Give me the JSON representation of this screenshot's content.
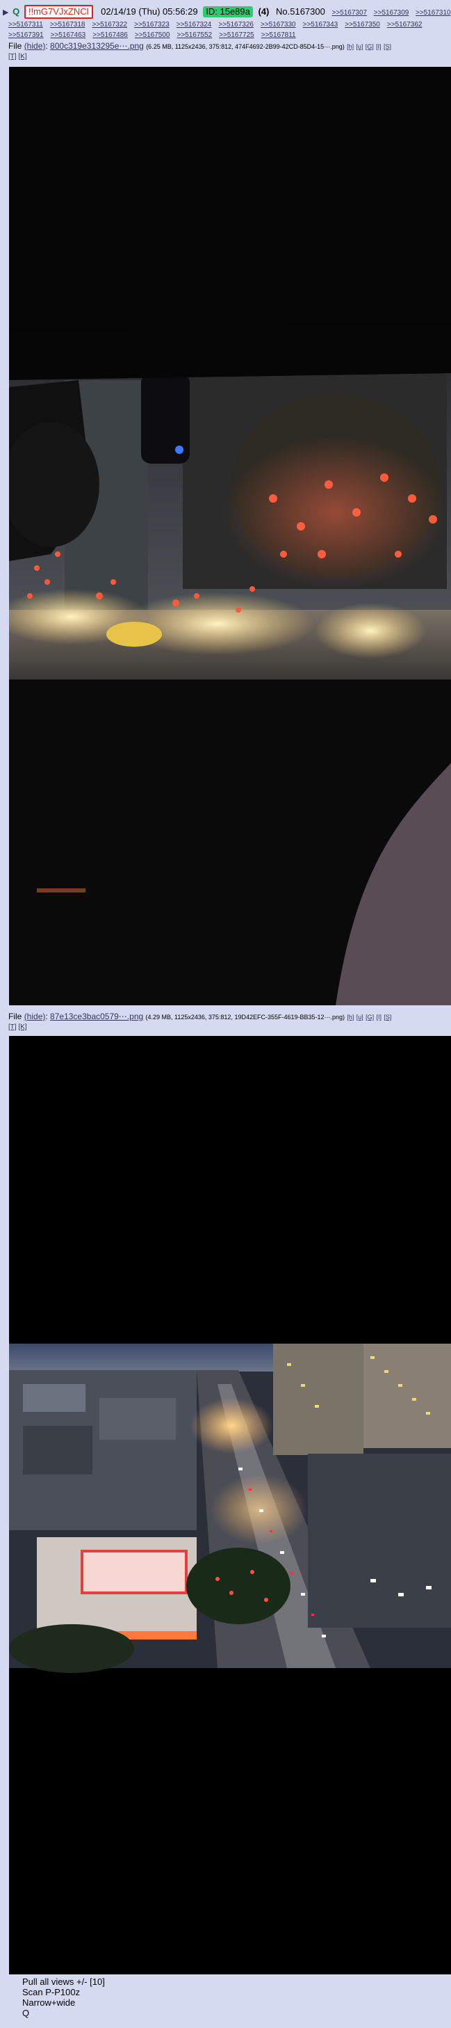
{
  "post": {
    "arrow": "▶",
    "q_badge": "Q",
    "tripcode": "!!mG7VJxZNCl",
    "datetime": "02/14/19 (Thu) 05:56:29",
    "id_label": "ID: 15e89a",
    "id_count": "(4)",
    "post_number": "No.5167300",
    "reply_links": [
      ">>5167307",
      ">>5167309",
      ">>5167310",
      ">>5167311",
      ">>5167318",
      ">>5167322",
      ">>5167323",
      ">>5167324",
      ">>5167326",
      ">>5167330",
      ">>5167343",
      ">>5167350",
      ">>5167362",
      ">>5167391",
      ">>5167463",
      ">>5167486",
      ">>5167500",
      ">>5167552",
      ">>5167725",
      ">>5167811"
    ],
    "bracket_links": [
      "[T]",
      "[K]"
    ]
  },
  "files": [
    {
      "label": "File",
      "hide": "(hide)",
      "filename": "800c319e313295e⋯.png",
      "meta": "(6.25 MB, 1125x2436, 375:812, 474F4692-2B99-42CD-85D4-15⋯.png)",
      "tools": [
        "[h]",
        "[u]",
        "[G]",
        "[I]",
        "[S]"
      ]
    },
    {
      "label": "File",
      "hide": "(hide)",
      "filename": "87e13ce3bac0579⋯.png",
      "meta": "(4.29 MB, 1125x2436, 375:812, 19D42EFC-355F-4619-BB35-12⋯.png)",
      "tools": [
        "[h]",
        "[u]",
        "[G]",
        "[I]",
        "[S]"
      ],
      "tools_extra": [
        "[T]",
        "[K]"
      ]
    }
  ],
  "footer": {
    "line1": "Pull all views +/- [10]",
    "line2": "Scan P-P100z",
    "line3": "Narrow+wide",
    "line4": "Q"
  },
  "colors": {
    "post_bg": "#d6daf0",
    "page_bg": "#eef2ff",
    "link": "#34345c",
    "trip_red": "#dd2222",
    "id_green": "#2ecc71"
  }
}
